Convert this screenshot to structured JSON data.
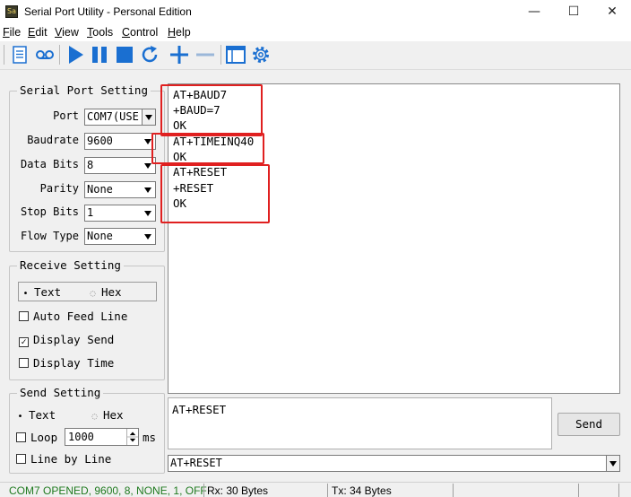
{
  "window": {
    "title": "Serial Port Utility - Personal Edition",
    "icon_text": "Sa",
    "minimize_glyph": "—",
    "maximize_glyph": "☐",
    "close_glyph": "✕"
  },
  "menu": [
    {
      "label": "File",
      "hotkey": "F",
      "rest": "ile"
    },
    {
      "label": "Edit",
      "hotkey": "E",
      "rest": "dit"
    },
    {
      "label": "View",
      "hotkey": "V",
      "rest": "iew"
    },
    {
      "label": "Tools",
      "hotkey": "T",
      "rest": "ools"
    },
    {
      "label": "Control",
      "hotkey": "C",
      "rest": "ontrol"
    },
    {
      "label": "Help",
      "hotkey": "H",
      "rest": "elp"
    }
  ],
  "toolbar": {
    "icons": [
      "document-icon",
      "record-icon",
      "play-icon",
      "pause-icon",
      "stop-icon",
      "refresh-icon",
      "plus-icon",
      "minus-icon",
      "window-icon",
      "gear-icon"
    ],
    "accent": "#1a6fd1"
  },
  "serial_port": {
    "title": "Serial Port Setting",
    "port_label": "Port",
    "port_value": "COM7(USE",
    "baudrate_label": "Baudrate",
    "baudrate_value": "9600",
    "databits_label": "Data Bits",
    "databits_value": "8",
    "parity_label": "Parity",
    "parity_value": "None",
    "stopbits_label": "Stop Bits",
    "stopbits_value": "1",
    "flow_label": "Flow Type",
    "flow_value": "None"
  },
  "receive": {
    "title": "Receive Setting",
    "text_label": "Text",
    "hex_label": "Hex",
    "auto_feed": "Auto Feed Line",
    "display_send": "Display Send",
    "display_time": "Display Time",
    "radio_on": "•",
    "radio_off": "◌",
    "check_mark": "✓"
  },
  "send": {
    "title": "Send Setting",
    "text_label": "Text",
    "hex_label": "Hex",
    "loop_label": "Loop",
    "loop_value": "1000",
    "loop_unit": "ms",
    "line_by_line": "Line by Line"
  },
  "output_lines": [
    "AT+BAUD7",
    "+BAUD=7",
    "OK",
    "AT+TIMEINQ40",
    "OK",
    "AT+RESET",
    "+RESET",
    "OK"
  ],
  "send_text": "AT+RESET",
  "send_button": "Send",
  "history_value": "AT+RESET",
  "status": {
    "connection": "COM7 OPENED, 9600, 8, NONE, 1, OFF",
    "connection_color": "#1f7a1f",
    "rx": "Rx: 30 Bytes",
    "tx": "Tx: 34 Bytes"
  },
  "highlight_color": "#e02020"
}
